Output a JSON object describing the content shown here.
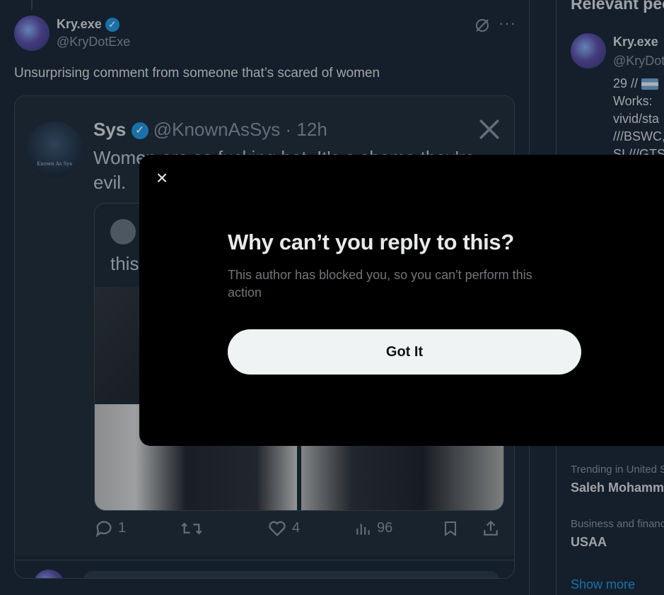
{
  "tweet": {
    "author_name": "Kry.exe",
    "author_handle": "@KryDotExe",
    "text": "Unsurprising comment from someone that’s scared of women"
  },
  "quoted": {
    "author_name": "Sys",
    "author_handle": "@KnownAsSys",
    "separator": "·",
    "time": "12h",
    "text_line1": "Women are so fucking hot. It's a shame they're",
    "text_line2": "evil.",
    "avatar_caption": "Known As Sys",
    "inner_text": "this"
  },
  "actions": {
    "replies": "1",
    "likes": "4",
    "views": "96"
  },
  "sidebar": {
    "heading": "Relevant people",
    "person_name": "Kry.exe",
    "person_handle": "@KryDotExe",
    "bio_line1": "29 //",
    "bio_line2": "Works:",
    "bio_line3": "vivid/sta",
    "bio_line4": "///BSWC,",
    "bio_line5": "SI ///GTS",
    "trend1_context": "Trending in United States",
    "trend1_name": "Saleh Mohammed",
    "trend2_context": "Business and finance",
    "trend2_name": "USAA",
    "show_more": "Show more"
  },
  "modal": {
    "title": "Why can’t you reply to this?",
    "body": "This author has blocked you, so you can't perform this action",
    "button": "Got It",
    "close_icon": "close-icon"
  },
  "colors": {
    "background": "#15202b",
    "accent": "#1d9bf0",
    "modal": "#000000"
  }
}
